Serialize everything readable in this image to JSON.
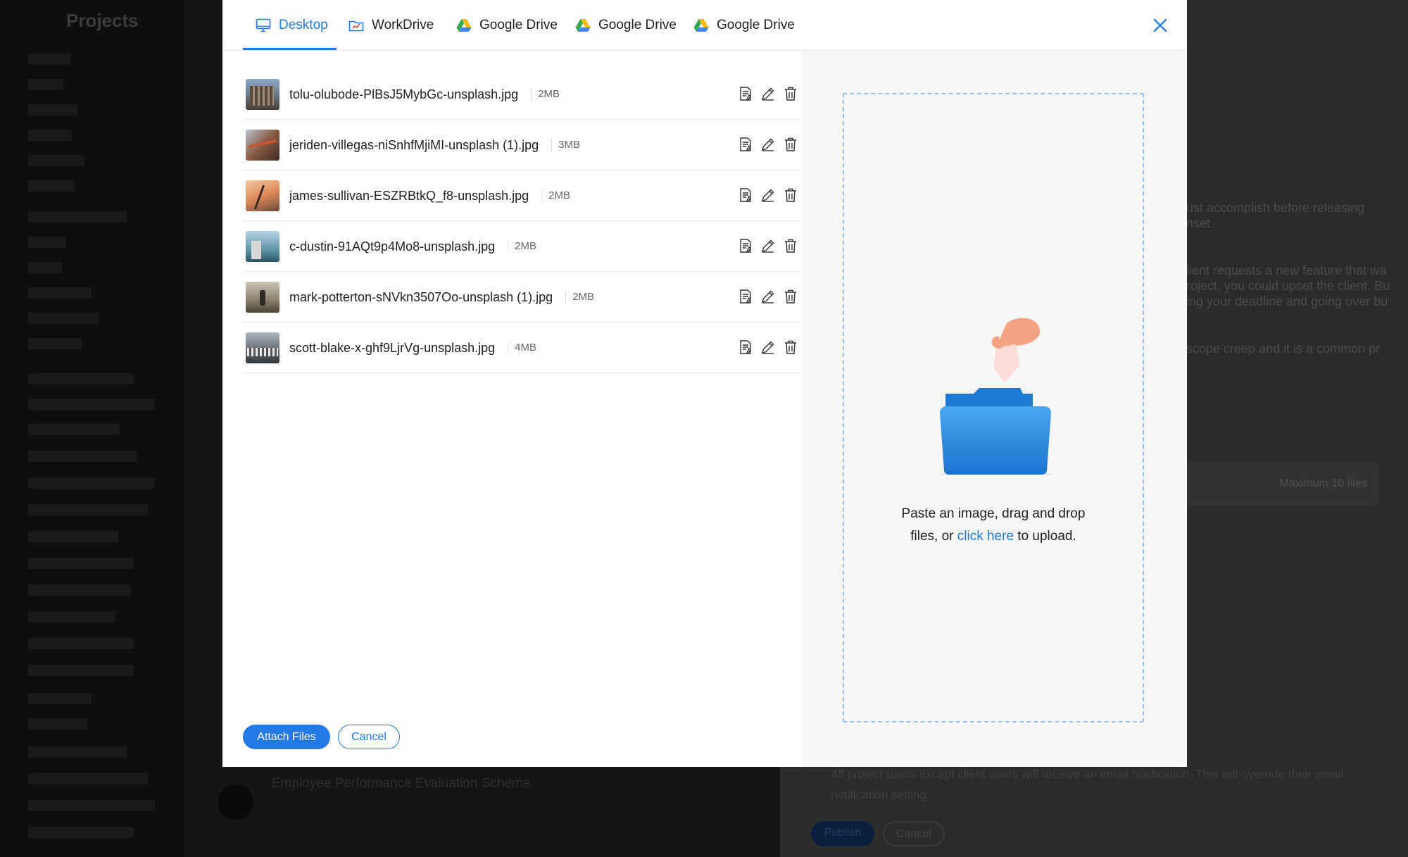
{
  "tabs": [
    {
      "label": "Desktop",
      "icon": "monitor-icon",
      "active": true
    },
    {
      "label": "WorkDrive",
      "icon": "workdrive-icon",
      "active": false
    },
    {
      "label": "Google Drive",
      "icon": "google-drive-icon",
      "active": false
    },
    {
      "label": "Google Drive",
      "icon": "google-drive-icon",
      "active": false
    },
    {
      "label": "Google Drive",
      "icon": "google-drive-icon",
      "active": false
    }
  ],
  "files": [
    {
      "name": "tolu-olubode-PlBsJ5MybGc-unsplash.jpg",
      "size": "2MB"
    },
    {
      "name": "jeriden-villegas-niSnhfMjiMI-unsplash (1).jpg",
      "size": "3MB"
    },
    {
      "name": "james-sullivan-ESZRBtkQ_f8-unsplash.jpg",
      "size": "2MB"
    },
    {
      "name": "c-dustin-91AQt9p4Mo8-unsplash.jpg",
      "size": "2MB"
    },
    {
      "name": "mark-potterton-sNVkn3507Oo-unsplash (1).jpg",
      "size": "2MB"
    },
    {
      "name": "scott-blake-x-ghf9LjrVg-unsplash.jpg",
      "size": "4MB"
    }
  ],
  "actions": {
    "attach_label": "Attach Files",
    "cancel_label": "Cancel"
  },
  "dropzone": {
    "line1": "Paste an image, drag and drop",
    "line2_prefix": "files, or ",
    "link": "click here",
    "line2_suffix": " to upload."
  },
  "background": {
    "sidebar_title": "Projects",
    "detail_line1": "ust accomplish before releasing",
    "detail_line2": "nset.",
    "detail_line3": "lient requests a new feature that wa",
    "detail_line4": "roject, you could upset the client. Bu",
    "detail_line5": "ing your deadline and going over bu",
    "detail_line6": "scope creep and it is a common pr",
    "max_files": "Maximum 10 files",
    "notification_note": "All project users except client users will receive an email notification. This will override their email notification setting.",
    "publish_label": "Publish",
    "cancel_label": "Cancel",
    "employee_title": "Employee Performance Evaluation Scheme"
  },
  "colors": {
    "accent": "#2379e6",
    "overlay": "#000000"
  }
}
